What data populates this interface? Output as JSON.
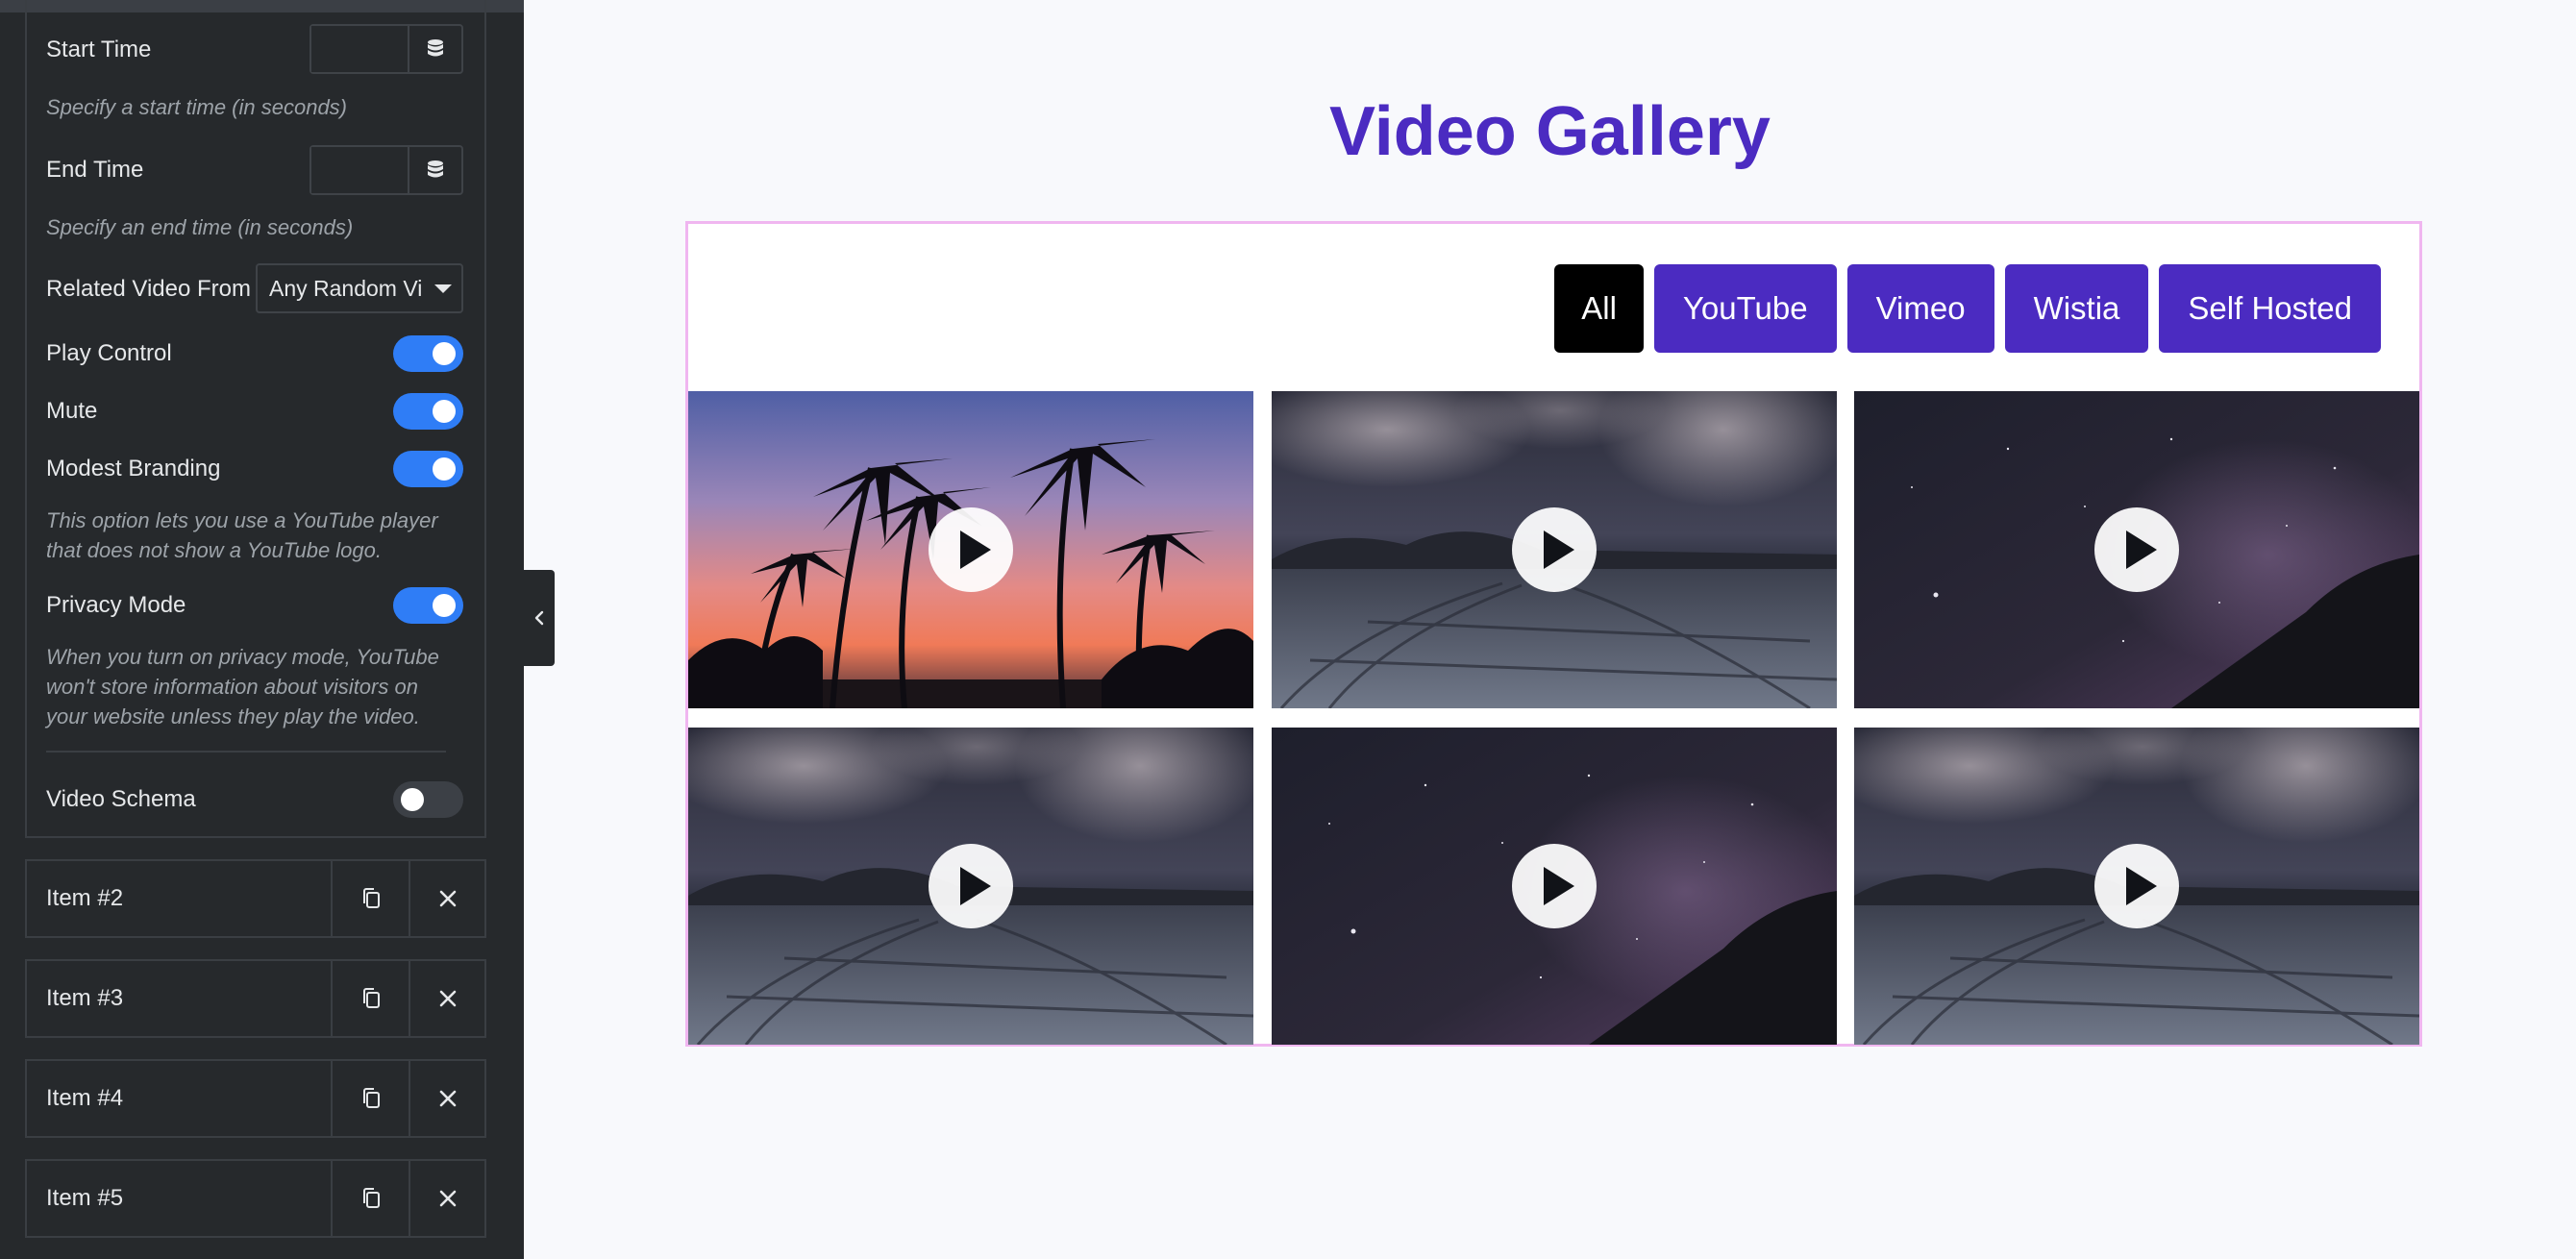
{
  "sidebar": {
    "start_time": {
      "label": "Start Time",
      "hint": "Specify a start time (in seconds)"
    },
    "end_time": {
      "label": "End Time",
      "hint": "Specify an end time (in seconds)"
    },
    "related_video": {
      "label": "Related Video From",
      "value": "Any Random Vi"
    },
    "play_control": {
      "label": "Play Control",
      "on": true
    },
    "mute": {
      "label": "Mute",
      "on": true
    },
    "modest_branding": {
      "label": "Modest Branding",
      "on": true,
      "hint": "This option lets you use a YouTube player that does not show a YouTube logo."
    },
    "privacy_mode": {
      "label": "Privacy Mode",
      "on": true,
      "hint": "When you turn on privacy mode, YouTube won't store information about visitors on your website unless they play the video."
    },
    "video_schema": {
      "label": "Video Schema",
      "on": false
    },
    "items": [
      {
        "label": "Item #2"
      },
      {
        "label": "Item #3"
      },
      {
        "label": "Item #4"
      },
      {
        "label": "Item #5"
      }
    ]
  },
  "preview": {
    "title": "Video Gallery",
    "filters": [
      "All",
      "YouTube",
      "Vimeo",
      "Wistia",
      "Self Hosted"
    ],
    "active_filter": "All",
    "colors": {
      "accent": "#4b2bc1",
      "active_filter": "#000000",
      "toggle_on": "#2f7df6"
    },
    "videos": [
      {
        "thumbnail": "palm-sunset"
      },
      {
        "thumbnail": "night-beach"
      },
      {
        "thumbnail": "milky-way"
      },
      {
        "thumbnail": "night-beach"
      },
      {
        "thumbnail": "milky-way"
      },
      {
        "thumbnail": "night-beach"
      }
    ]
  }
}
